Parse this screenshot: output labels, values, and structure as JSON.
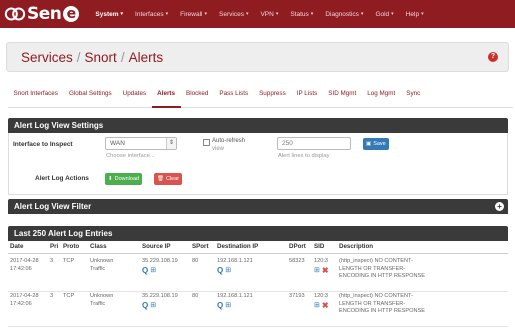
{
  "nav": {
    "logo_text": "Sen",
    "logo_badge": "e",
    "menu": [
      "System",
      "Interfaces",
      "Firewall",
      "Services",
      "VPN",
      "Status",
      "Diagnostics",
      "Gold",
      "Help"
    ]
  },
  "header": {
    "crumb1": "Services",
    "crumb2": "Snort",
    "crumb3": "Alerts",
    "sep": "/",
    "help_icon": "?"
  },
  "tabs": [
    "Snort Interfaces",
    "Global Settings",
    "Updates",
    "Alerts",
    "Blocked",
    "Pass Lists",
    "Suppress",
    "IP Lists",
    "SID Mgmt",
    "Log Mgmt",
    "Sync"
  ],
  "active_tab": "Alerts",
  "settings": {
    "heading": "Alert Log View Settings",
    "interface_label": "Interface to Inspect",
    "interface_value": "WAN",
    "interface_help": "Choose interface...",
    "autorefresh_label": "Auto-refresh",
    "autorefresh_sub": "view",
    "lines_value": "250",
    "lines_help": "Alert lines to display",
    "save_label": "Save",
    "actions_label": "Alert Log Actions",
    "download_label": "Download",
    "clear_label": "Clear"
  },
  "filter": {
    "heading": "Alert Log View Filter",
    "toggle_icon": "+"
  },
  "entries": {
    "heading": "Last 250 Alert Log Entries",
    "columns": [
      "Date",
      "Pri",
      "Proto",
      "Class",
      "Source IP",
      "SPort",
      "Destination IP",
      "DPort",
      "SID",
      "Description"
    ],
    "rows": [
      {
        "date1": "2017-04-28",
        "date2": "17:42:06",
        "pri": "3",
        "proto": "TCP",
        "class1": "Unknown",
        "class2": "Traffic",
        "src": "35.229.108.19",
        "sport": "80",
        "dst": "192.168.1.121",
        "dport": "58323",
        "sid1": "120:3",
        "desc1": "(http_inspect) NO CONTENT-",
        "desc2": "LENGTH OR TRANSFER-",
        "desc3": "ENCODING IN HTTP RESPONSE"
      },
      {
        "date1": "2017-04-28",
        "date2": "17:42:06",
        "pri": "3",
        "proto": "TCP",
        "class1": "Unknown",
        "class2": "Traffic",
        "src": "35.229.108.19",
        "sport": "80",
        "dst": "192.168.1.121",
        "dport": "37193",
        "sid1": "120:3",
        "desc1": "(http_inspect) NO CONTENT-",
        "desc2": "LENGTH OR TRANSFER-",
        "desc3": "ENCODING IN HTTP RESPONSE"
      }
    ]
  },
  "colors": {
    "brand": "#8e1c21",
    "panel_heading": "#3a3a3a",
    "primary": "#337ab7",
    "success": "#4cae4c",
    "danger": "#d9534f"
  }
}
